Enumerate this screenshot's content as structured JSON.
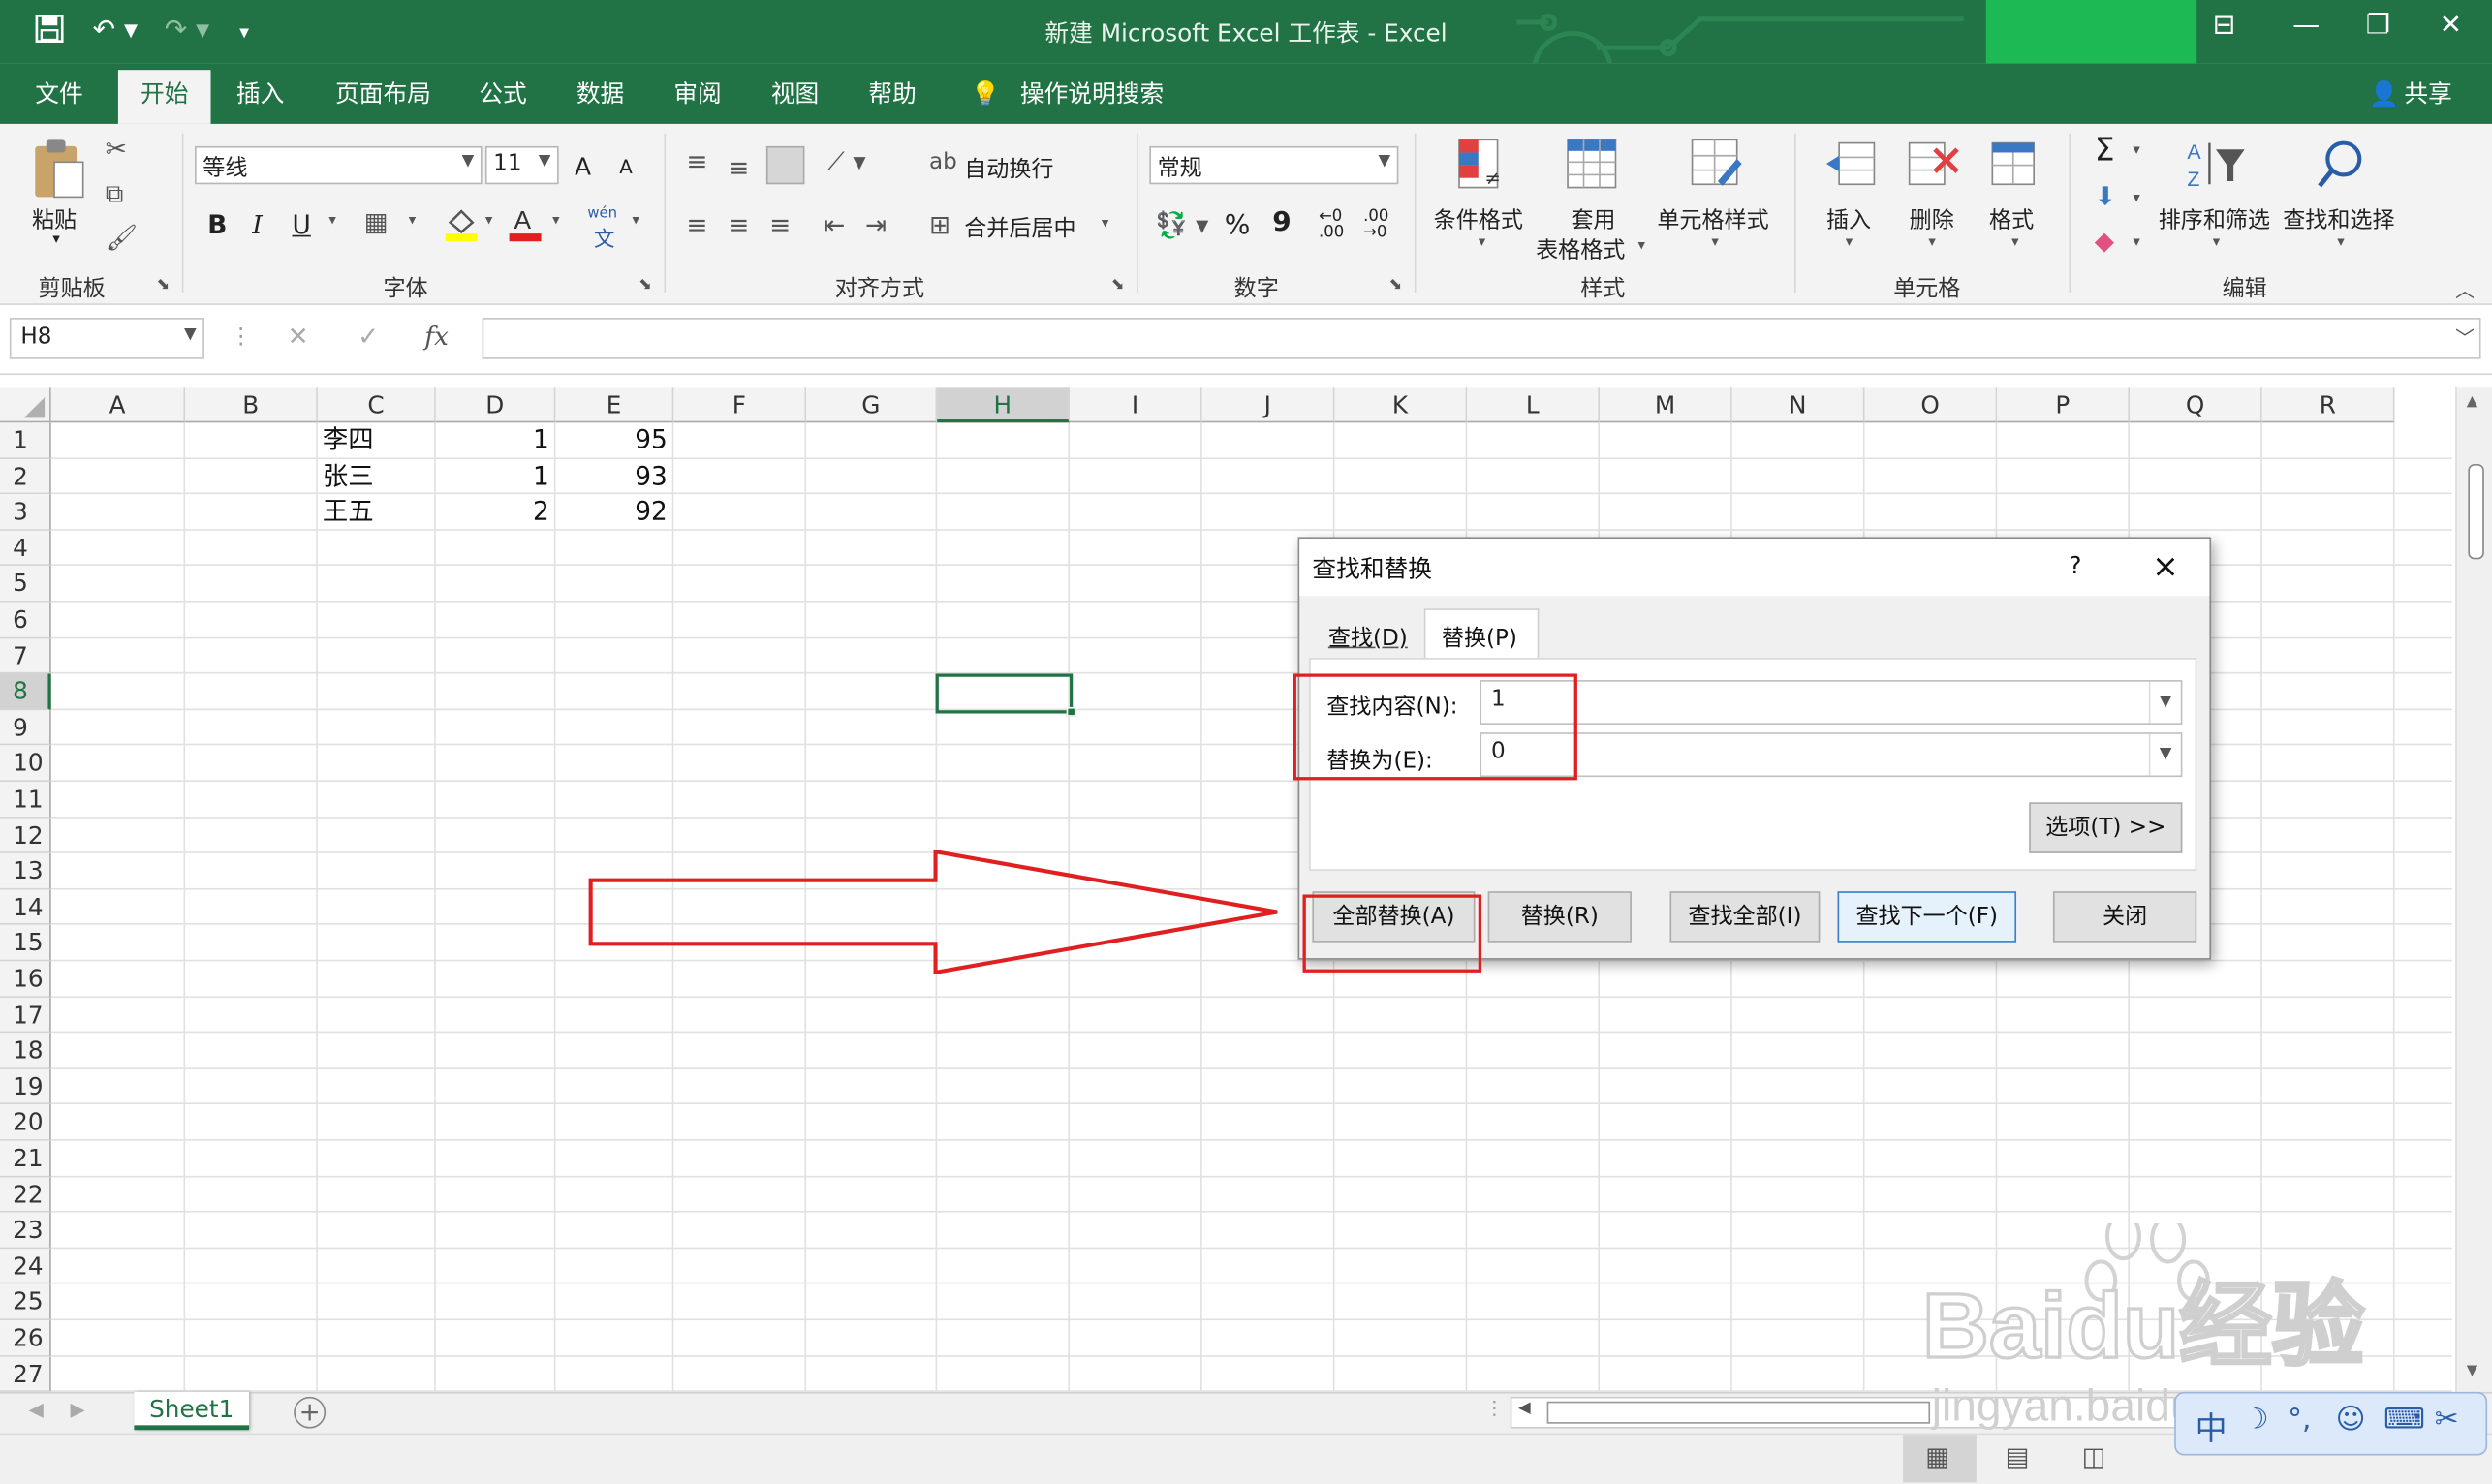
{
  "window": {
    "title": "新建 Microsoft Excel 工作表  -  Excel",
    "share_label": "共享"
  },
  "menu": {
    "tabs": [
      "文件",
      "开始",
      "插入",
      "页面布局",
      "公式",
      "数据",
      "审阅",
      "视图",
      "帮助"
    ],
    "active_tab": "开始",
    "tell_me": "操作说明搜索"
  },
  "ribbon": {
    "clipboard": {
      "label": "剪贴板",
      "paste": "粘贴"
    },
    "font": {
      "label": "字体",
      "name": "等线",
      "size": "11",
      "bold": "B",
      "italic": "I",
      "underline": "U",
      "grow": "A",
      "shrink": "A",
      "wen": "wén"
    },
    "alignment": {
      "label": "对齐方式",
      "wrap": "自动换行",
      "merge": "合并后居中"
    },
    "number": {
      "label": "数字",
      "format": "常规",
      "percent": "%",
      "comma": "9",
      "inc_decimal": "←0 .00",
      "dec_decimal": ".00 →0"
    },
    "styles": {
      "label": "样式",
      "conditional": "条件格式",
      "table_line1": "套用",
      "table_line2": "表格格式",
      "cell_styles": "单元格样式"
    },
    "cells": {
      "label": "单元格",
      "insert": "插入",
      "delete": "删除",
      "format": "格式"
    },
    "editing": {
      "label": "编辑",
      "sort_filter": "排序和筛选",
      "find_select": "查找和选择",
      "sigma": "Σ"
    }
  },
  "formula_bar": {
    "name_box": "H8",
    "fx": "fx",
    "value": ""
  },
  "grid": {
    "columns": [
      "A",
      "B",
      "C",
      "D",
      "E",
      "F",
      "G",
      "H",
      "I",
      "J",
      "K",
      "L",
      "M",
      "N",
      "O",
      "P",
      "Q",
      "R"
    ],
    "selected_column": "H",
    "rows": [
      "1",
      "2",
      "3",
      "4",
      "5",
      "6",
      "7",
      "8",
      "9",
      "10",
      "11",
      "12",
      "13",
      "14",
      "15",
      "16",
      "17",
      "18",
      "19",
      "20",
      "21",
      "22",
      "23",
      "24",
      "25",
      "26",
      "27"
    ],
    "selected_row": "8",
    "data": [
      {
        "C": "李四",
        "D": "1",
        "E": "95"
      },
      {
        "C": "张三",
        "D": "1",
        "E": "93"
      },
      {
        "C": "王五",
        "D": "2",
        "E": "92"
      }
    ]
  },
  "sheets": {
    "tabs": [
      "Sheet1"
    ],
    "active": "Sheet1",
    "add": "+"
  },
  "dialog": {
    "title": "查找和替换",
    "help": "?",
    "close": "×",
    "tabs": [
      "查找(D)",
      "替换(P)"
    ],
    "active_tab": "替换(P)",
    "find_label": "查找内容(N):",
    "find_value": "1",
    "replace_label": "替换为(E):",
    "replace_value": "0",
    "options": "选项(T) >>",
    "buttons": {
      "replace_all": "全部替换(A)",
      "replace": "替换(R)",
      "find_all": "查找全部(I)",
      "find_next": "查找下一个(F)",
      "close": "关闭"
    }
  },
  "annotation": {
    "color": "#e02020"
  },
  "watermark": {
    "brand": "Baidu经验",
    "url": "jingyan.baidu.com",
    "ime": "中"
  },
  "colors": {
    "excel_green": "#217346",
    "selection_green": "#217346"
  }
}
